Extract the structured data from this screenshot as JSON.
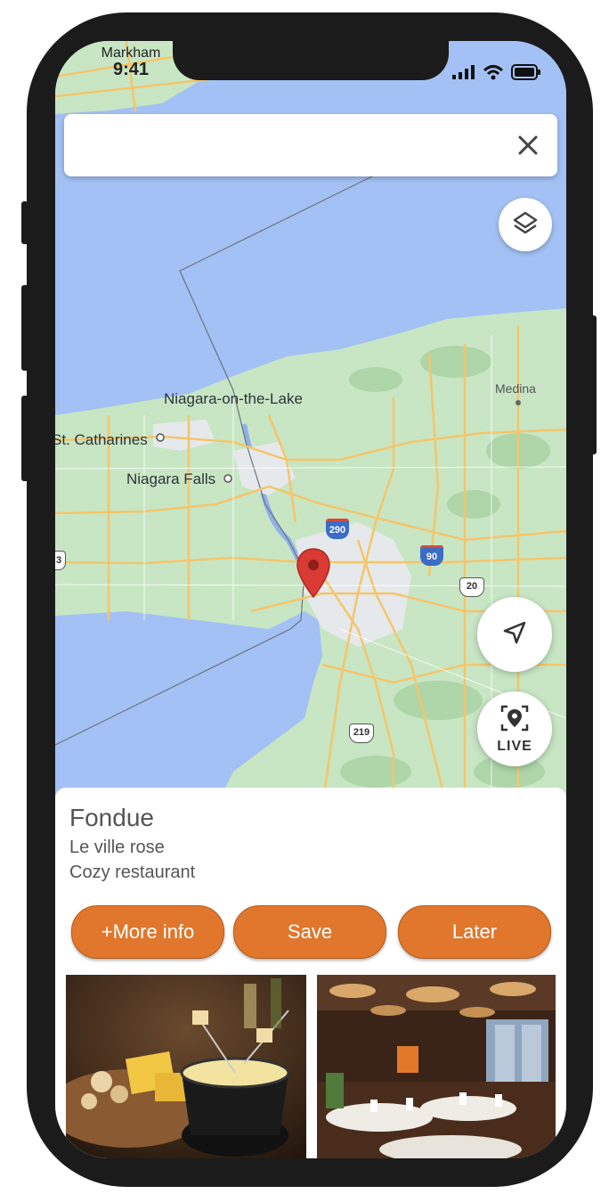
{
  "status_bar": {
    "location_label": "Markham",
    "time": "9:41"
  },
  "search": {
    "value": "",
    "placeholder": ""
  },
  "map": {
    "labels": {
      "niagara_on_the_lake": "Niagara-on-the-Lake",
      "st_catharines": "St. Catharines",
      "niagara_falls": "Niagara Falls",
      "medina": "Medina"
    },
    "highway_shields": {
      "i290": "290",
      "i90": "90",
      "us20": "20",
      "us219": "219",
      "route3": "3"
    }
  },
  "controls": {
    "live_label": "LIVE"
  },
  "place_card": {
    "title": "Fondue",
    "subtitle": "Le ville rose",
    "description": "Cozy restaurant",
    "buttons": {
      "more_info": "+More info",
      "save": "Save",
      "later": "Later"
    }
  },
  "colors": {
    "accent": "#e0772c",
    "water": "#a3c1f4",
    "land": "#c8e6c4",
    "roads": "#f5c56a",
    "pin": "#d93a34"
  },
  "icons": {
    "close": "close-icon",
    "layers": "layers-icon",
    "navigate": "navigation-arrow-icon",
    "live": "live-view-pin-icon",
    "signal": "cellular-signal-icon",
    "wifi": "wifi-icon",
    "battery": "battery-icon"
  }
}
